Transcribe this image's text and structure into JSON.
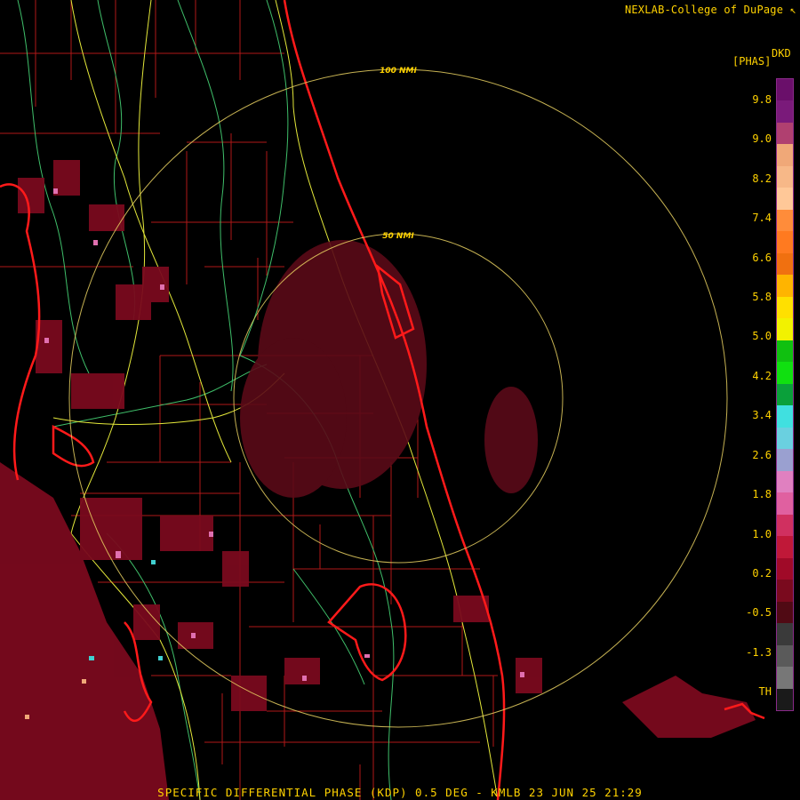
{
  "header": {
    "credit": "NEXLAB-College of DuPage ↖"
  },
  "legend": {
    "product_code": "DKD",
    "unit": "[PHAS]",
    "tick_labels": [
      "9.8",
      "9.0",
      "8.2",
      "7.4",
      "6.6",
      "5.8",
      "5.0",
      "4.2",
      "3.4",
      "2.6",
      "1.8",
      "1.0",
      "0.2",
      "-0.5",
      "-1.3",
      "TH"
    ],
    "colors": [
      "#6a0f6a",
      "#7a1a7a",
      "#b04070",
      "#f0a878",
      "#f7b888",
      "#ffc898",
      "#ff8c3a",
      "#ff7a20",
      "#f07010",
      "#ffb400",
      "#ffe000",
      "#f2f200",
      "#10c010",
      "#10e010",
      "#0aa03a",
      "#40e0e0",
      "#6ad0e0",
      "#9aa0d0",
      "#e080c0",
      "#e060a0",
      "#d03060",
      "#c01838",
      "#a00a28",
      "#7a0a1e",
      "#500a14",
      "#3a3a3a",
      "#5a5a5a",
      "#777777",
      "#1a1a1a"
    ]
  },
  "range_rings": [
    {
      "label": "100 NMI"
    },
    {
      "label": "50 NMI"
    }
  ],
  "footer": {
    "caption": "SPECIFIC DIFFERENTIAL PHASE (KDP) 0.5 DEG - KMLB 23 JUN 25 21:29"
  }
}
